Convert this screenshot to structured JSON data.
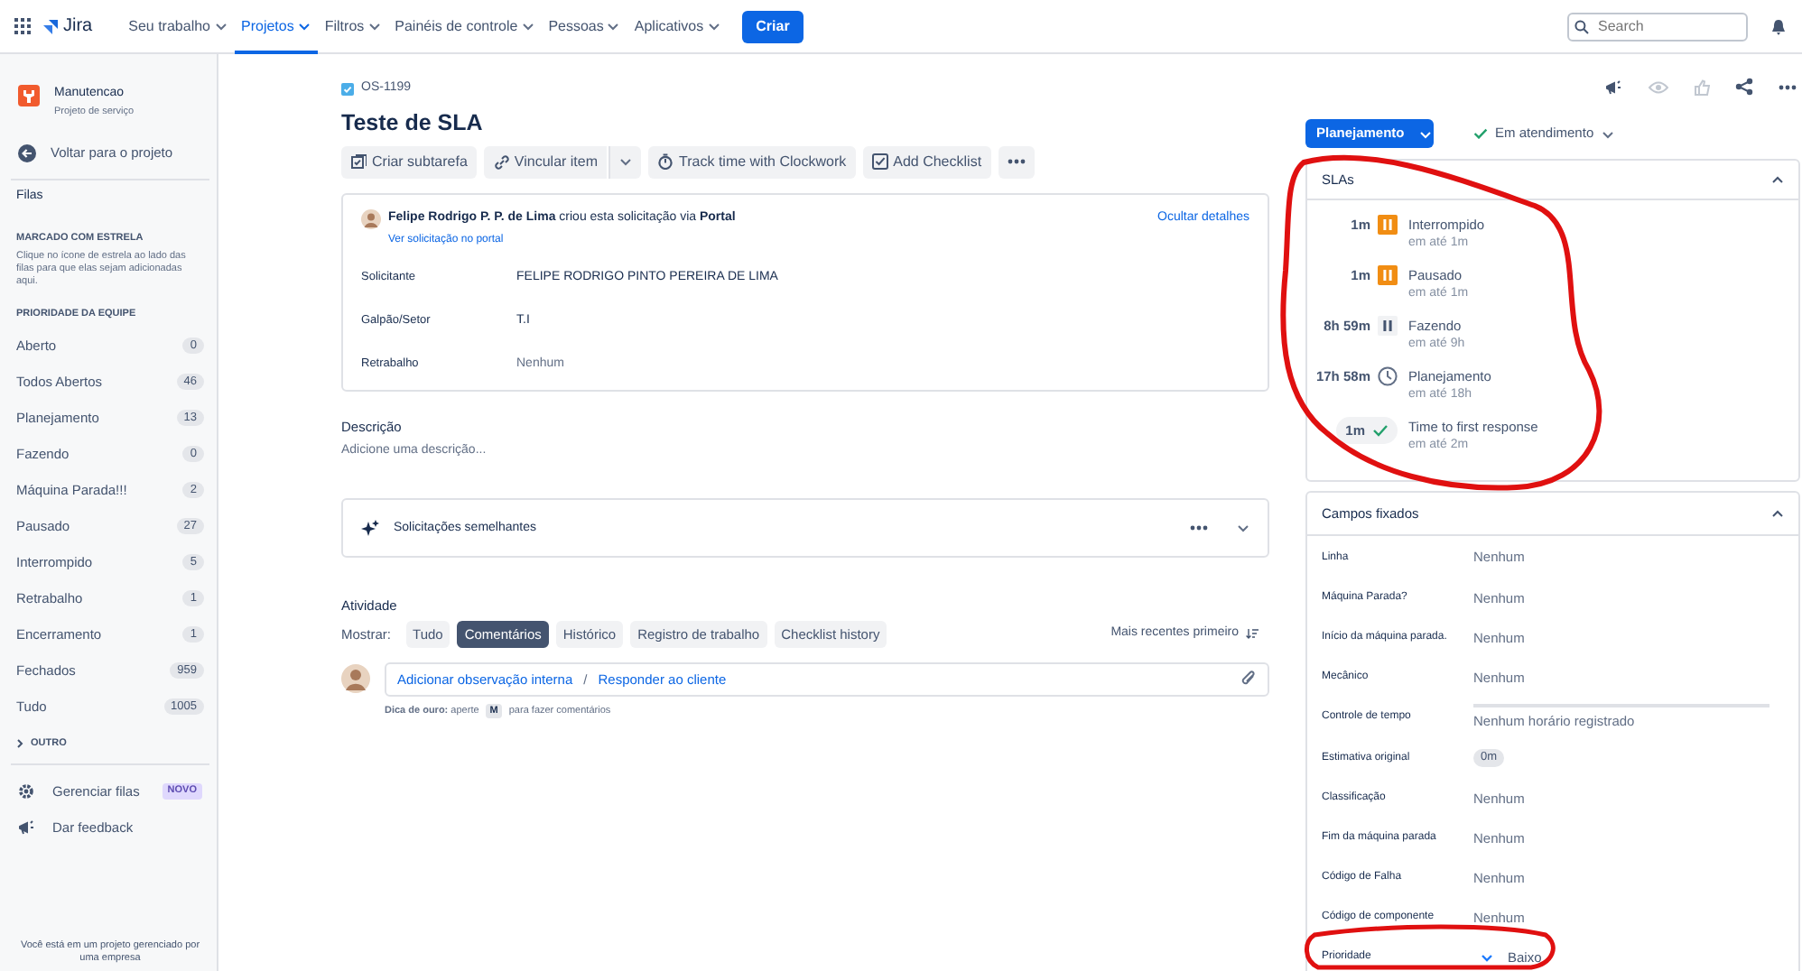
{
  "nav": {
    "logo": "Jira",
    "items": [
      {
        "label": "Seu trabalho",
        "selected": false
      },
      {
        "label": "Projetos",
        "selected": true
      },
      {
        "label": "Filtros",
        "selected": false
      },
      {
        "label": "Painéis de controle",
        "selected": false
      },
      {
        "label": "Pessoas",
        "selected": false
      },
      {
        "label": "Aplicativos",
        "selected": false
      }
    ],
    "create": "Criar",
    "search": {
      "placeholder": "Search"
    }
  },
  "sidebar": {
    "project": {
      "name": "Manutencao",
      "type": "Projeto de serviço"
    },
    "back": "Voltar para o projeto",
    "section": "Filas",
    "starred": {
      "heading": "MARCADO COM ESTRELA",
      "hint": "Clique no ícone de estrela ao lado das filas para que elas sejam adicionadas aqui."
    },
    "team": {
      "heading": "PRIORIDADE DA EQUIPE",
      "queues": [
        {
          "label": "Aberto",
          "count": "0"
        },
        {
          "label": "Todos Abertos",
          "count": "46"
        },
        {
          "label": "Planejamento",
          "count": "13"
        },
        {
          "label": "Fazendo",
          "count": "0"
        },
        {
          "label": "Máquina Parada!!!",
          "count": "2"
        },
        {
          "label": "Pausado",
          "count": "27"
        },
        {
          "label": "Interrompido",
          "count": "5"
        },
        {
          "label": "Retrabalho",
          "count": "1"
        },
        {
          "label": "Encerramento",
          "count": "1"
        },
        {
          "label": "Fechados",
          "count": "959"
        },
        {
          "label": "Tudo",
          "count": "1005"
        }
      ]
    },
    "other": "OUTRO",
    "links": [
      {
        "kind": "gear",
        "label": "Gerenciar filas",
        "badge": "NOVO"
      },
      {
        "kind": "megaphone",
        "label": "Dar feedback"
      }
    ],
    "note": "Você está em um projeto gerenciado por uma empresa"
  },
  "issue": {
    "key": "OS-1199",
    "title": "Teste de SLA",
    "toolbar": [
      {
        "kind": "subtask",
        "label": "Criar subtarefa"
      },
      {
        "kind": "link",
        "label": "Vincular item"
      },
      {
        "kind": "timer",
        "label": "Track time with Clockwork"
      },
      {
        "kind": "checklist",
        "label": "Add Checklist"
      }
    ],
    "request": {
      "text": "**Felipe Rodrigo P. P. de Lima** criou esta solicitação via **Portal**",
      "portal_link": "Ver solicitação no portal",
      "hide": "Ocultar detalhes",
      "fields": [
        {
          "label": "Solicitante",
          "value": "FELIPE RODRIGO PINTO PEREIRA DE LIMA",
          "empty": false
        },
        {
          "label": "Galpão/Setor",
          "value": "T.I",
          "empty": false
        },
        {
          "label": "Retrabalho",
          "value": "Nenhum",
          "empty": true
        }
      ]
    },
    "description": {
      "label": "Descrição",
      "placeholder": "Adicione uma descrição..."
    },
    "similar": "Solicitações semelhantes",
    "activity": {
      "heading": "Atividade",
      "show": "Mostrar:",
      "filters": [
        {
          "label": "Tudo",
          "selected": false
        },
        {
          "label": "Comentários",
          "selected": true
        },
        {
          "label": "Histórico",
          "selected": false
        },
        {
          "label": "Registro de trabalho",
          "selected": false
        },
        {
          "label": "Checklist history",
          "selected": false
        }
      ],
      "sort": "Mais recentes primeiro",
      "internal": "Adicionar observação interna",
      "separator": "/",
      "reply": "Responder ao cliente",
      "tip": "**Dica de ouro:** aperte",
      "tip_key": "M",
      "tip_end": "para fazer comentários"
    }
  },
  "panel": {
    "status": "Planejamento",
    "resolution": "Em atendimento",
    "slas": {
      "title": "SLAs",
      "items": [
        {
          "time": "1m",
          "kind": "paused-warn",
          "name": "Interrompido",
          "goal": "em até 1m"
        },
        {
          "time": "1m",
          "kind": "paused-warn",
          "name": "Pausado",
          "goal": "em até 1m"
        },
        {
          "time": "8h 59m",
          "kind": "paused",
          "name": "Fazendo",
          "goal": "em até 9h"
        },
        {
          "time": "17h 58m",
          "kind": "running",
          "name": "Planejamento",
          "goal": "em até 18h"
        },
        {
          "time": "1m",
          "kind": "met",
          "name": "Time to first response",
          "goal": "em até 2m"
        }
      ]
    },
    "fields": {
      "title": "Campos fixados",
      "items": [
        {
          "label": "Linha",
          "value": "Nenhum",
          "kind": "text"
        },
        {
          "label": "Máquina Parada?",
          "value": "Nenhum",
          "kind": "text"
        },
        {
          "label": "Início da máquina parada.",
          "value": "Nenhum",
          "kind": "text"
        },
        {
          "label": "Mecânico",
          "value": "Nenhum",
          "kind": "text"
        },
        {
          "label": "Controle de tempo",
          "value": "Nenhum horário registrado",
          "kind": "time"
        },
        {
          "label": "Estimativa original",
          "value": "0m",
          "kind": "tag"
        },
        {
          "label": "Classificação",
          "value": "Nenhum",
          "kind": "text"
        },
        {
          "label": "Fim da máquina parada",
          "value": "Nenhum",
          "kind": "text"
        },
        {
          "label": "Código de Falha",
          "value": "Nenhum",
          "kind": "text"
        },
        {
          "label": "Código de componente",
          "value": "Nenhum",
          "kind": "text"
        },
        {
          "label": "Prioridade",
          "value": "Baixo",
          "kind": "priority"
        }
      ]
    }
  }
}
